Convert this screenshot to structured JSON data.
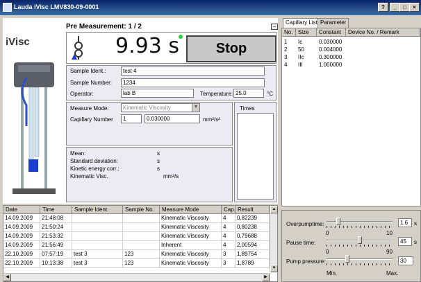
{
  "window": {
    "title": "Lauda iVisc  LMV830-09-0001",
    "buttons": [
      "?",
      "_",
      "□",
      "×"
    ]
  },
  "brand": {
    "logo_text": "iVisc"
  },
  "measurement": {
    "header": "Pre Measurement: 1 / 2",
    "time_value": "9.93 s",
    "stop_label": "Stop",
    "minimize_symbol": "−"
  },
  "sample": {
    "ident_label": "Sample Ident.:",
    "ident_value": "test 4",
    "number_label": "Sample Number:",
    "number_value": "1234",
    "operator_label": "Operator:",
    "operator_value": "lab B",
    "temperature_label": "Temperature:",
    "temperature_value": "25.0",
    "temperature_unit": "°C"
  },
  "mode": {
    "measure_mode_label": "Measure Mode:",
    "measure_mode_value": "Kinematic Viscosity",
    "capillary_label": "Capillary Number",
    "capillary_number": "1",
    "capillary_constant": "0.030000",
    "capillary_unit": "mm²/s²",
    "times_label": "Times"
  },
  "results": {
    "mean_label": "Mean:",
    "mean_unit": "s",
    "std_label": "Standard deviation:",
    "std_unit": "s",
    "kinetic_label": "Kinetic energy corr.:",
    "kinetic_unit": "s",
    "visc_label": "Kinematic Visc.",
    "visc_unit": "mm²/s"
  },
  "history": {
    "columns": [
      "Date",
      "Time",
      "Sample Ident.",
      "Sample No.",
      "Measure Mode",
      "Cap.",
      "Result"
    ],
    "rows": [
      [
        "14.09.2009",
        "21:48:08",
        "",
        "",
        "Kinematic Viscosity",
        "4",
        "0,82239"
      ],
      [
        "14.09.2009",
        "21:50:24",
        "",
        "",
        "Kinematic Viscosity",
        "4",
        "0,80238"
      ],
      [
        "14.09.2009",
        "21:53:32",
        "",
        "",
        "Kinematic Viscosity",
        "4",
        "0,79688"
      ],
      [
        "14.09.2009",
        "21:56:49",
        "",
        "",
        "Inherent",
        "4",
        "2,00594"
      ],
      [
        "22.10.2009",
        "07:57:19",
        "test 3",
        "123",
        "Kinematic Viscosity",
        "3",
        "1,89754"
      ],
      [
        "22.10.2009",
        "10:13:38",
        "test 3",
        "123",
        "Kinematic Viscosity",
        "3",
        "1,8789"
      ]
    ]
  },
  "capillary_tabs": {
    "tab_capillary": "Capillary List",
    "tab_parameter": "Parameter",
    "columns": [
      "No.",
      "Size",
      "Constant",
      "Device No. / Remark"
    ],
    "rows": [
      [
        "1",
        "Ic",
        "0.030000",
        ""
      ],
      [
        "2",
        "50",
        "0.004000",
        ""
      ],
      [
        "3",
        "IIc",
        "0.300000",
        ""
      ],
      [
        "4",
        "III",
        "1.000000",
        ""
      ]
    ]
  },
  "params": {
    "overpump_label": "Overpumptime:",
    "overpump_value": "1.6",
    "overpump_unit": "s",
    "overpump_min": "0",
    "overpump_max": "10",
    "overpump_level": 0.16,
    "pause_label": "Pause time:",
    "pause_value": "45",
    "pause_unit": "s",
    "pause_min": "0",
    "pause_max": "90",
    "pause_level": 0.5,
    "pressure_label": "Pump pressure:",
    "pressure_value": "30",
    "pressure_min_label": "Min.",
    "pressure_max_label": "Max.",
    "pressure_level": 0.3
  }
}
